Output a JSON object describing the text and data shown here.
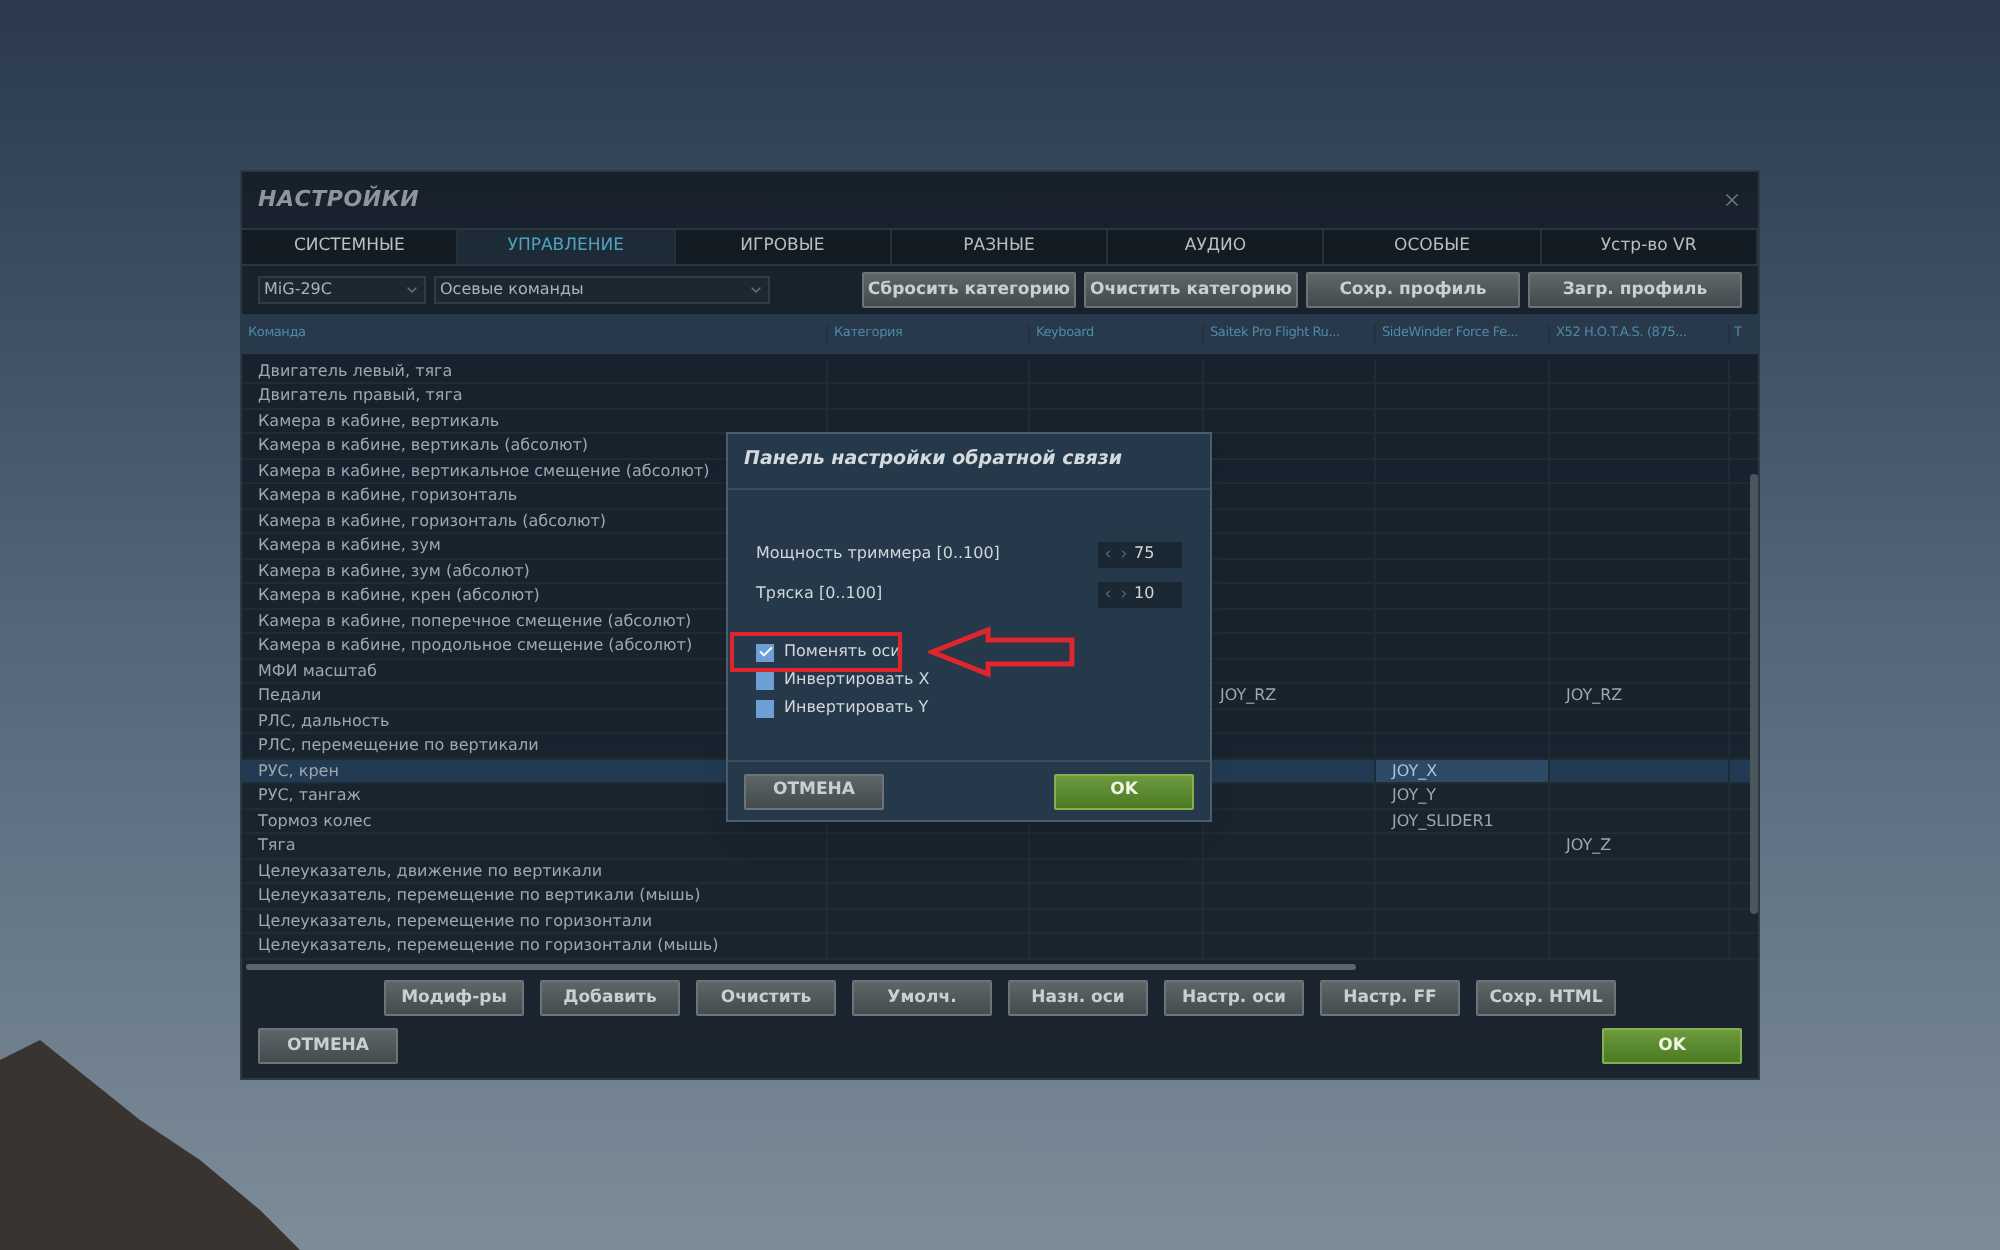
{
  "window": {
    "title": "НАСТРОЙКИ"
  },
  "tabs": [
    {
      "label": "СИСТЕМНЫЕ",
      "selected": false
    },
    {
      "label": "УПРАВЛЕНИЕ",
      "selected": true
    },
    {
      "label": "ИГРОВЫЕ",
      "selected": false
    },
    {
      "label": "РАЗНЫЕ",
      "selected": false
    },
    {
      "label": "АУДИО",
      "selected": false
    },
    {
      "label": "ОСОБЫЕ",
      "selected": false
    },
    {
      "label": "Устр-во VR",
      "selected": false
    }
  ],
  "toolbar": {
    "aircraft": "MiG-29C",
    "category": "Осевые команды",
    "buttons": [
      "Сбросить категорию",
      "Очистить категорию",
      "Сохр. профиль",
      "Загр. профиль"
    ]
  },
  "table": {
    "columns": [
      "Команда",
      "Категория",
      "Keyboard",
      "Saitek Pro Flight Ru...",
      "SideWinder Force Fe...",
      "X52 H.O.T.A.S. (875...",
      "T"
    ],
    "rows": [
      {
        "selected": false,
        "cells": [
          "Двигатель левый, тяга",
          null,
          null,
          null,
          null,
          null,
          null
        ]
      },
      {
        "selected": false,
        "cells": [
          "Двигатель правый, тяга",
          null,
          null,
          null,
          null,
          null,
          null
        ]
      },
      {
        "selected": false,
        "cells": [
          "Камера в кабине, вертикаль",
          null,
          null,
          null,
          null,
          null,
          null
        ]
      },
      {
        "selected": false,
        "cells": [
          "Камера в кабине, вертикаль (абсолют)",
          null,
          null,
          null,
          null,
          null,
          null
        ]
      },
      {
        "selected": false,
        "cells": [
          "Камера в кабине, вертикальное смещение (абсолют)",
          null,
          null,
          null,
          null,
          null,
          null
        ]
      },
      {
        "selected": false,
        "cells": [
          "Камера в кабине, горизонталь",
          null,
          null,
          null,
          null,
          null,
          null
        ]
      },
      {
        "selected": false,
        "cells": [
          "Камера в кабине, горизонталь (абсолют)",
          null,
          null,
          null,
          null,
          null,
          null
        ]
      },
      {
        "selected": false,
        "cells": [
          "Камера в кабине, зум",
          null,
          null,
          null,
          null,
          null,
          null
        ]
      },
      {
        "selected": false,
        "cells": [
          "Камера в кабине, зум (абсолют)",
          null,
          null,
          null,
          null,
          null,
          null
        ]
      },
      {
        "selected": false,
        "cells": [
          "Камера в кабине, крен (абсолют)",
          null,
          null,
          null,
          null,
          null,
          null
        ]
      },
      {
        "selected": false,
        "cells": [
          "Камера в кабине, поперечное смещение (абсолют)",
          null,
          null,
          null,
          null,
          null,
          null
        ]
      },
      {
        "selected": false,
        "cells": [
          "Камера в кабине, продольное смещение (абсолют)",
          null,
          null,
          null,
          null,
          null,
          null
        ]
      },
      {
        "selected": false,
        "cells": [
          "МФИ масштаб",
          null,
          null,
          null,
          null,
          null,
          null
        ]
      },
      {
        "selected": false,
        "cells": [
          "Педали",
          null,
          null,
          "JOY_RZ",
          null,
          "JOY_RZ",
          null
        ]
      },
      {
        "selected": false,
        "cells": [
          "РЛС, дальность",
          null,
          null,
          null,
          null,
          null,
          null
        ]
      },
      {
        "selected": false,
        "cells": [
          "РЛС, перемещение по вертикали",
          null,
          null,
          null,
          null,
          null,
          null
        ]
      },
      {
        "selected": true,
        "cells": [
          "РУС, крен",
          null,
          null,
          null,
          "JOY_X",
          null,
          null
        ]
      },
      {
        "selected": false,
        "cells": [
          "РУС, тангаж",
          null,
          null,
          null,
          "JOY_Y",
          null,
          null
        ]
      },
      {
        "selected": false,
        "cells": [
          "Тормоз колес",
          null,
          null,
          null,
          "JOY_SLIDER1",
          null,
          null
        ]
      },
      {
        "selected": false,
        "cells": [
          "Тяга",
          null,
          null,
          null,
          null,
          "JOY_Z",
          null
        ]
      },
      {
        "selected": false,
        "cells": [
          "Целеуказатель, движение по вертикали",
          null,
          null,
          null,
          null,
          null,
          null
        ]
      },
      {
        "selected": false,
        "cells": [
          "Целеуказатель, перемещение по вертикали (мышь)",
          null,
          null,
          null,
          null,
          null,
          null
        ]
      },
      {
        "selected": false,
        "cells": [
          "Целеуказатель, перемещение по горизонтали",
          null,
          null,
          null,
          null,
          null,
          null
        ]
      },
      {
        "selected": false,
        "cells": [
          "Целеуказатель, перемещение по горизонтали (мышь)",
          null,
          null,
          null,
          null,
          null,
          null
        ]
      }
    ]
  },
  "action_buttons": [
    "Модиф-ры",
    "Добавить",
    "Очистить",
    "Умолч.",
    "Назн. оси",
    "Настр. оси",
    "Настр. FF",
    "Сохр. HTML"
  ],
  "footer": {
    "cancel": "ОТМЕНА",
    "ok": "OK"
  },
  "dialog": {
    "title": "Панель настройки обратной связи",
    "fields": [
      {
        "label": "Мощность триммера [0..100]",
        "value": "75"
      },
      {
        "label": "Тряска [0..100]",
        "value": "10"
      }
    ],
    "checkboxes": [
      {
        "label": "Поменять оси",
        "checked": true,
        "highlighted": true
      },
      {
        "label": "Инвертировать X",
        "checked": false,
        "highlighted": false
      },
      {
        "label": "Инвертировать Y",
        "checked": false,
        "highlighted": false
      }
    ],
    "cancel": "ОТМЕНА",
    "ok": "OK"
  }
}
